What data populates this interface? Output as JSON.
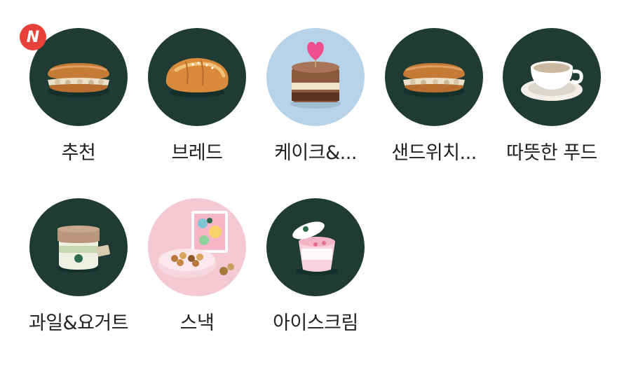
{
  "colors": {
    "dark_bg": "#1f3b34",
    "cake_bg": "#b7d3e9",
    "snack_bg": "#f4c9d4",
    "badge": "#e8413a"
  },
  "categories": [
    {
      "label": "추천",
      "image": "sandwich-icon",
      "badge": "N"
    },
    {
      "label": "브레드",
      "image": "bread-roll-icon"
    },
    {
      "label": "케이크&...",
      "image": "cake-icon"
    },
    {
      "label": "샌드위치...",
      "image": "sandwich-icon"
    },
    {
      "label": "따뜻한 푸드",
      "image": "soup-cup-icon"
    },
    {
      "label": "과일&요거트",
      "image": "yogurt-jar-icon"
    },
    {
      "label": "스낵",
      "image": "cookie-box-icon"
    },
    {
      "label": "아이스크림",
      "image": "ice-cream-cup-icon"
    }
  ]
}
